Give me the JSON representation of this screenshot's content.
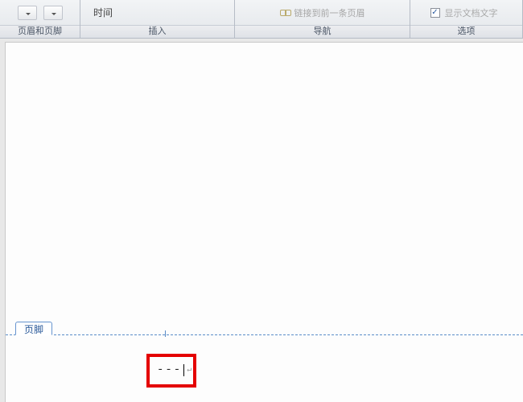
{
  "ribbon": {
    "group1": {
      "label": "页眉和页脚"
    },
    "group2": {
      "label": "插入",
      "time_item": "时间"
    },
    "group3": {
      "label": "导航",
      "link_prev": "链接到前一条页眉"
    },
    "group4": {
      "label": "选项",
      "show_doc_text": "显示文档文字",
      "checked": true
    }
  },
  "document": {
    "footer_tab": "页脚",
    "footer_dashes": "---"
  }
}
